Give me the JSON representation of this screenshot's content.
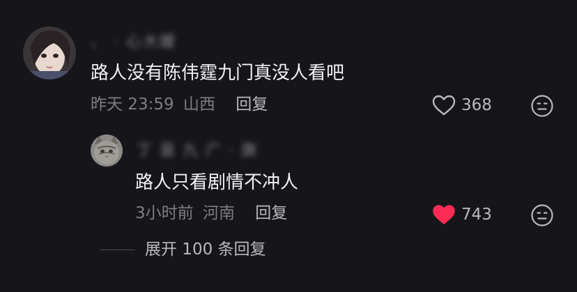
{
  "comment": {
    "username": "、 · 心大嫒",
    "text": "路人没有陈伟霆九门真没人看吧",
    "time": "昨天 23:59",
    "location": "山西",
    "reply_label": "回复",
    "like_count": "368",
    "liked": false
  },
  "reply": {
    "username": "丁 苗 九 广 · 旗",
    "text": "路人只看剧情不冲人",
    "time": "3小时前",
    "location": "河南",
    "reply_label": "回复",
    "like_count": "743",
    "liked": true
  },
  "expand_label": "展开 100 条回复",
  "colors": {
    "background": "#16161a",
    "like_active": "#fe2c55",
    "text_primary": "#f2f2f4",
    "text_secondary": "#7d7d83"
  },
  "icons": {
    "like": "heart-outline-icon",
    "liked": "heart-filled-icon",
    "dislike": "meh-face-icon"
  }
}
